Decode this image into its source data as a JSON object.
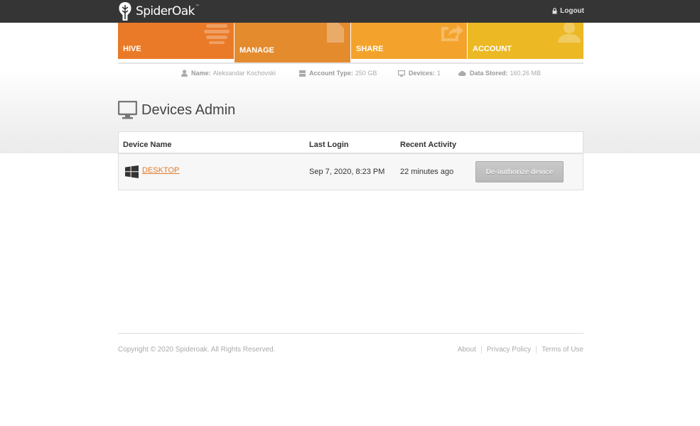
{
  "header": {
    "brand": "SpiderOak",
    "brand_tm": "™",
    "logout_label": "Logout"
  },
  "tiles": [
    {
      "label": "HIVE",
      "color": "#ea7a27",
      "icon": "stack-icon"
    },
    {
      "label": "MANAGE",
      "color": "#e48b2e",
      "icon": "document-icon",
      "active": true
    },
    {
      "label": "SHARE",
      "color": "#f3a32c",
      "icon": "share-icon"
    },
    {
      "label": "ACCOUNT",
      "color": "#ecb925",
      "icon": "user-icon"
    }
  ],
  "stats": {
    "name_label": "Name:",
    "name_value": "Aleksandar Kochovski",
    "account_type_label": "Account Type:",
    "account_type_value": "250 GB",
    "devices_label": "Devices:",
    "devices_value": "1",
    "data_stored_label": "Data Stored:",
    "data_stored_value": "160.26 MB"
  },
  "page": {
    "title": "Devices Admin"
  },
  "table": {
    "headers": [
      "Device Name",
      "Last Login",
      "Recent Activity"
    ],
    "rows": [
      {
        "device_name": "DESKTOP",
        "os_icon": "windows-icon",
        "last_login": "Sep 7, 2020, 8:23 PM",
        "recent_activity": "22 minutes ago",
        "action_label": "De-authorize device"
      }
    ]
  },
  "footer": {
    "copyright": "Copyright © 2020 Spideroak. All Rights Reserved.",
    "links": [
      "About",
      "Privacy Policy",
      "Terms of Use"
    ]
  },
  "colors": {
    "topbar": "#353535",
    "accent_link": "#e07b2a"
  }
}
